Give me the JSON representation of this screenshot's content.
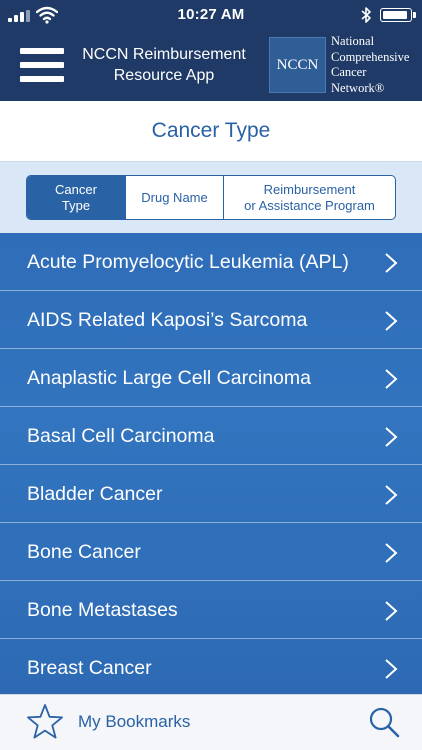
{
  "status_bar": {
    "time": "10:27 AM",
    "signal_icon": "signal-bars-icon",
    "wifi_icon": "wifi-icon",
    "bluetooth_icon": "bluetooth-icon",
    "battery_icon": "battery-icon"
  },
  "header": {
    "menu_icon": "hamburger-menu-icon",
    "app_title_line1": "NCCN Reimbursement",
    "app_title_line2": "Resource App",
    "logo_mark": "NCCN",
    "logo_words": [
      "National",
      "Comprehensive",
      "Cancer",
      "Network®"
    ]
  },
  "page": {
    "title": "Cancer Type"
  },
  "segments": [
    {
      "line1": "Cancer",
      "line2": "Type",
      "active": true
    },
    {
      "line1": "Drug Name",
      "line2": "",
      "active": false
    },
    {
      "line1": "Reimbursement",
      "line2": "or Assistance Program",
      "active": false
    }
  ],
  "list": {
    "items": [
      "Acute Promyelocytic Leukemia (APL)",
      "AIDS Related Kaposi’s Sarcoma",
      "Anaplastic Large Cell Carcinoma",
      "Basal Cell Carcinoma",
      "Bladder Cancer",
      "Bone Cancer",
      "Bone Metastases",
      "Breast Cancer"
    ],
    "item_icon": "chevron-right-icon"
  },
  "bottom_bar": {
    "bookmark_icon": "star-icon",
    "bookmarks_label": "My Bookmarks",
    "search_icon": "search-icon"
  },
  "colors": {
    "header_bg": "#1f3a66",
    "accent": "#2a62a6",
    "list_bg": "#3274bf",
    "segment_bar_bg": "#d9e7f6"
  }
}
